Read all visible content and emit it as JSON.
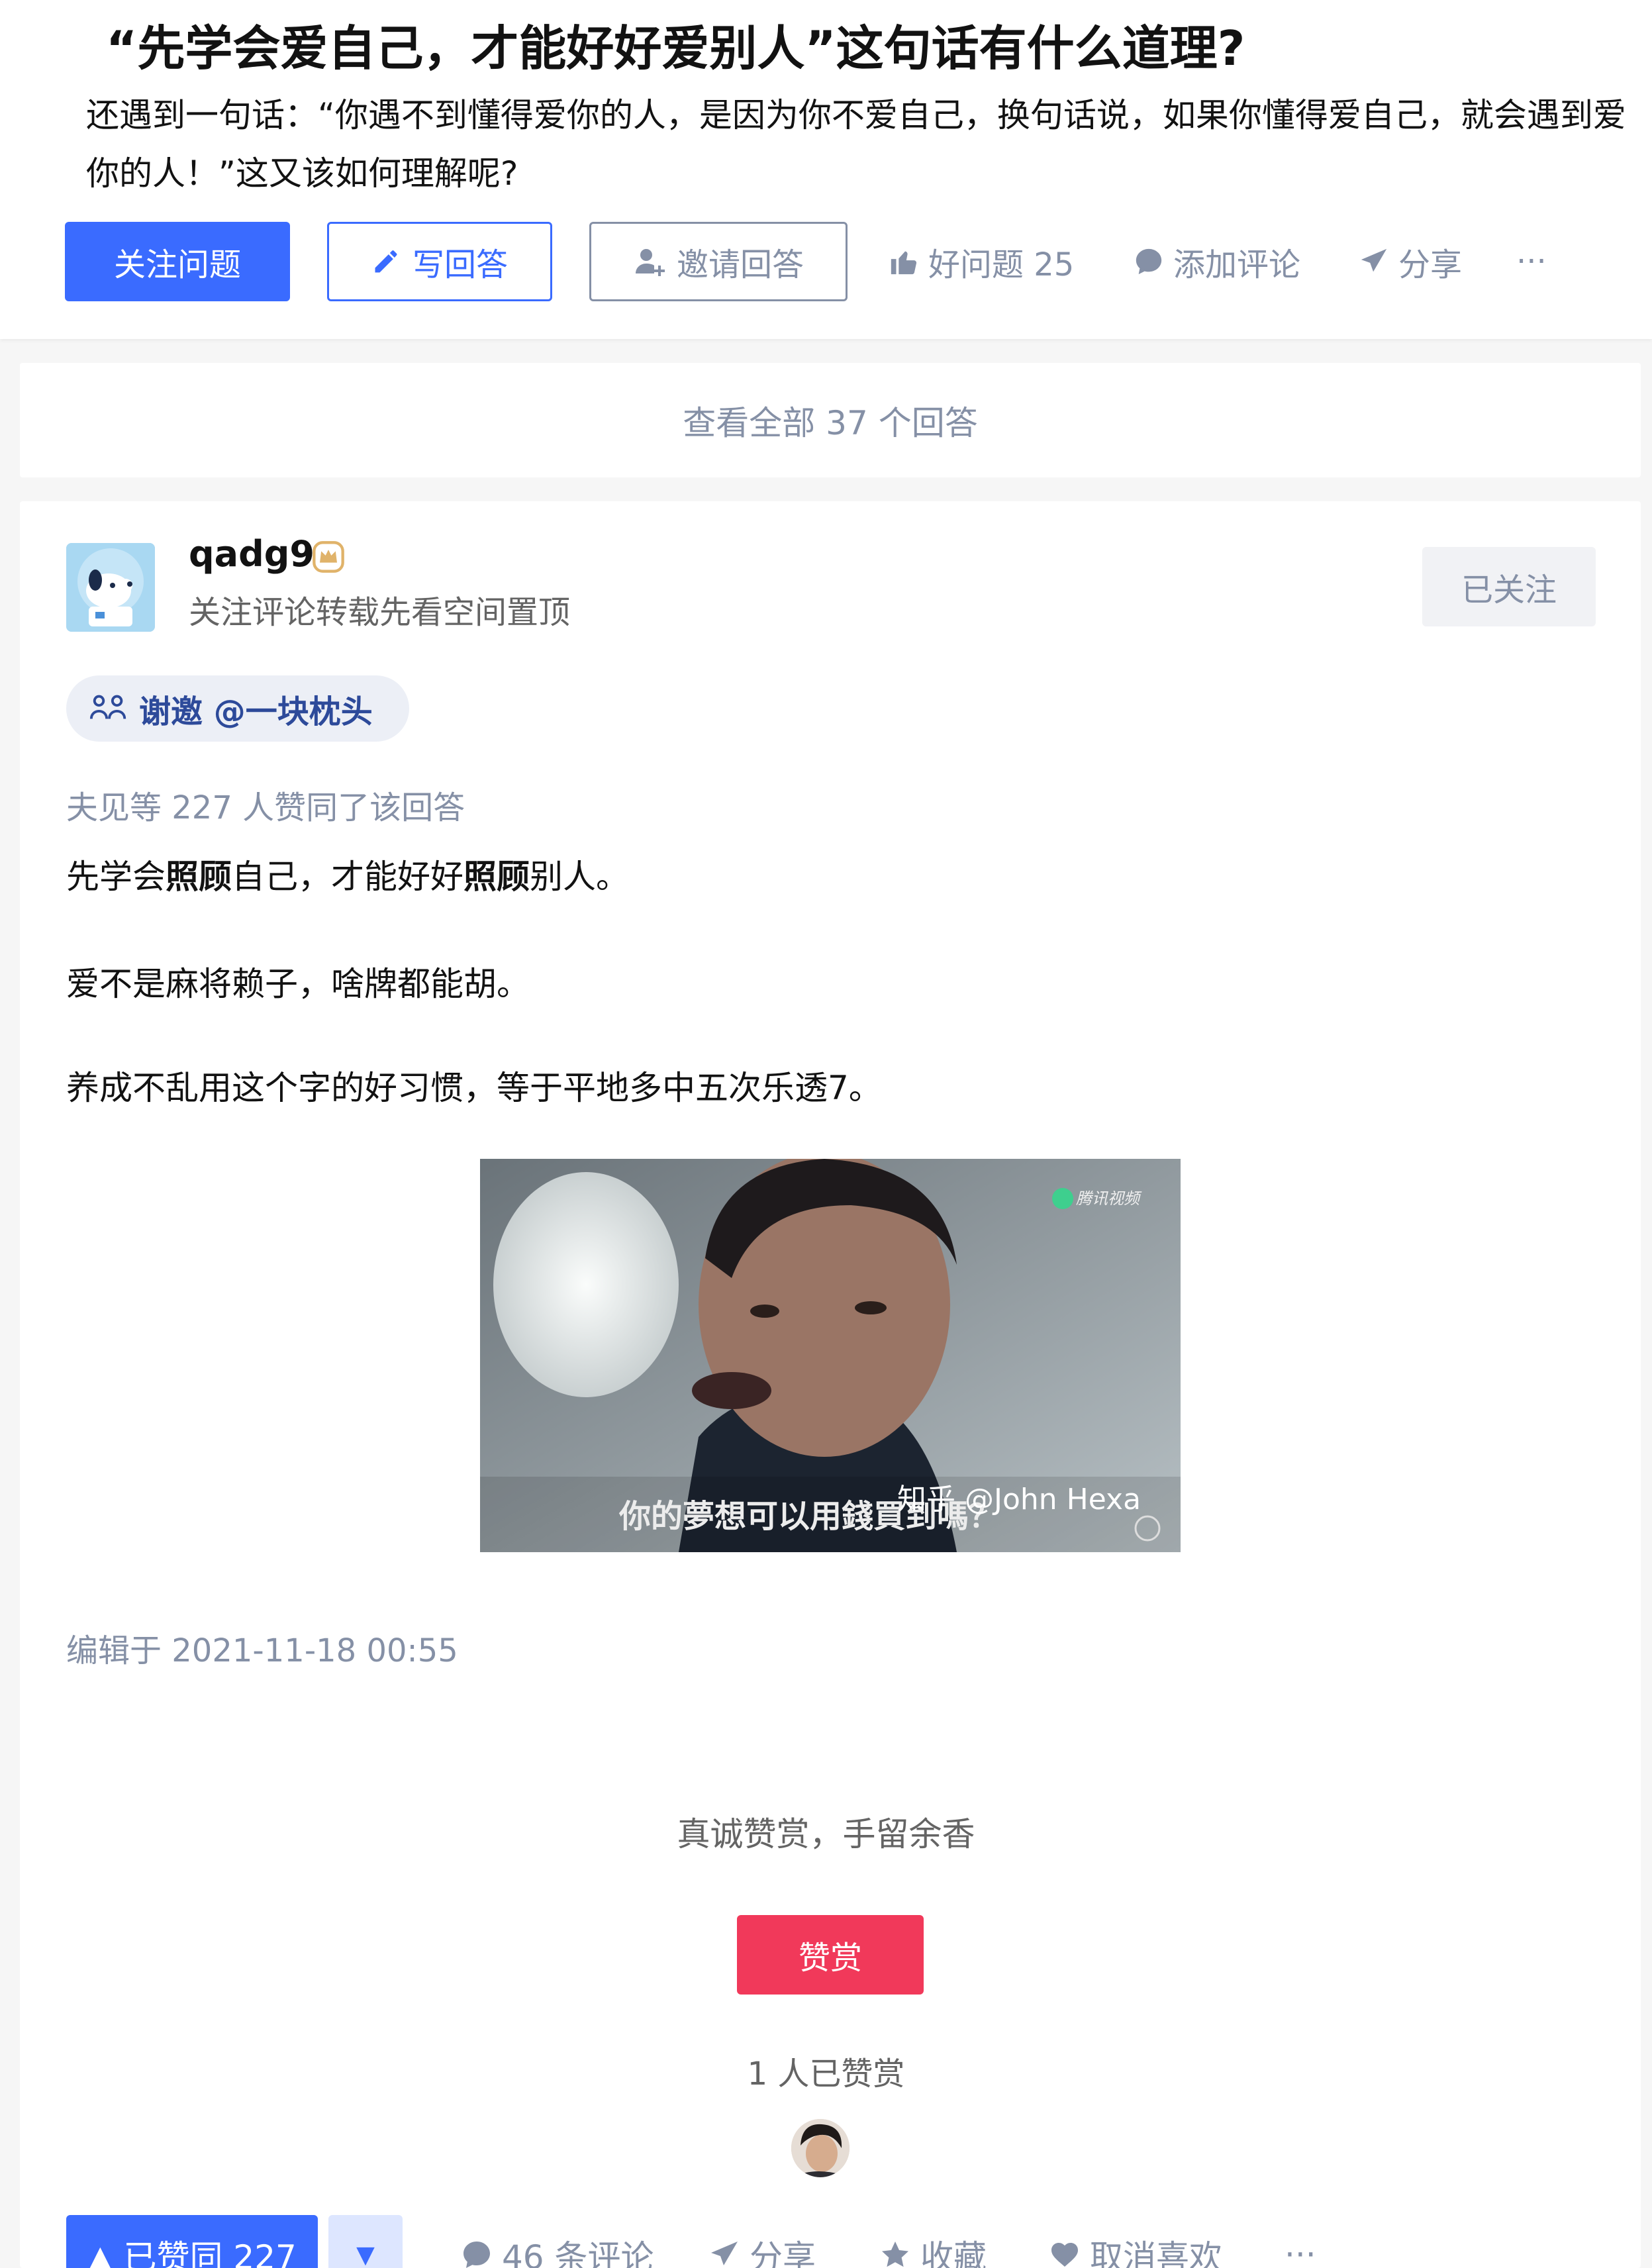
{
  "question": {
    "title": "“先学会爱自己，才能好好爱别人”这句话有什么道理?",
    "description": "还遇到一句话：“你遇不到懂得爱你的人，是因为你不爱自己，换句话说，如果你懂得爱自己，就会遇到爱你的人！”这又该如何理解呢?",
    "follow_label": "关注问题",
    "write_label": "写回答",
    "invite_label": "邀请回答",
    "good_question_label": "好问题 25",
    "comment_label": "添加评论",
    "share_label": "分享",
    "more_label": "···"
  },
  "view_all_label": "查看全部 37 个回答",
  "answer": {
    "author_name": "qadg9",
    "author_bio": "关注评论转载先看空间置顶",
    "followed_label": "已关注",
    "thanks_label": "谢邀 @一块枕头",
    "vote_info": "夫见等 227 人赞同了该回答",
    "para1_a": "先学会",
    "para1_b": "照顾",
    "para1_c": "自己，才能好好",
    "para1_d": "照顾",
    "para1_e": "别人。",
    "para2": "爱不是麻将赖子，啥牌都能胡。",
    "para3": "养成不乱用这个字的好习惯，等于平地多中五次乐透7。",
    "image_caption": "你的夢想可以用錢買到嗎？",
    "image_watermark": "知乎 @John Hexa",
    "image_logo_text": "腾讯视频",
    "edit_time": "编辑于 2021-11-18 00:55",
    "reward_text": "真诚赞赏，手留余香",
    "reward_button": "赞赏",
    "reward_count": "1 人已赞赏",
    "vote_up_label": "▲ 已赞同 227",
    "vote_down_label": "▼",
    "comments_label": "46 条评论",
    "share_label": "分享",
    "collect_label": "收藏",
    "unlike_label": "取消喜欢",
    "more_label": "···"
  },
  "colors": {
    "accent": "#3a6bff",
    "reward": "#f1395a",
    "muted": "#8590a6"
  }
}
